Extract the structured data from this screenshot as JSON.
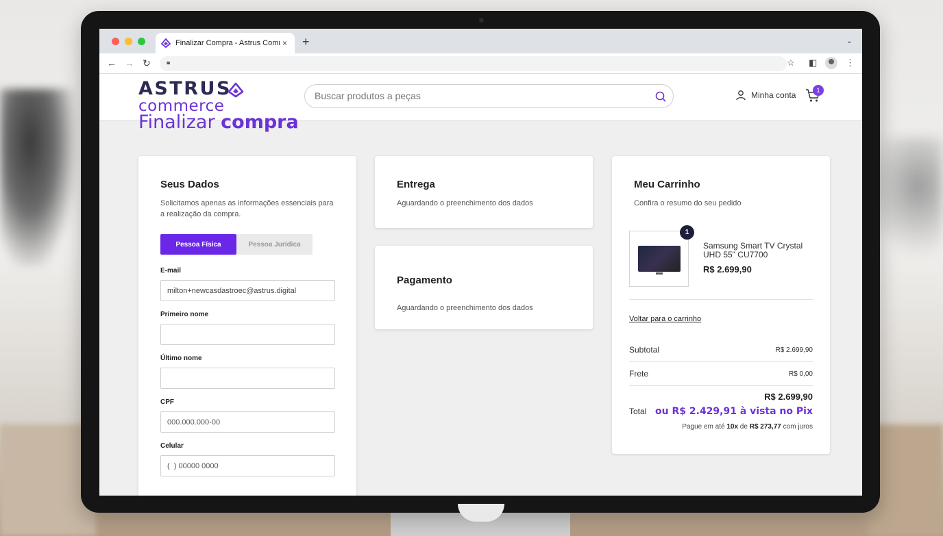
{
  "browser": {
    "tab_title": "Finalizar Compra - Astrus Commerce",
    "new_tab_symbol": "+",
    "close_symbol": "×"
  },
  "header": {
    "logo_top": "ASTRUS",
    "logo_bottom": "commerce",
    "search_placeholder": "Buscar produtos a peças",
    "account_label": "Minha conta",
    "cart_count": "1"
  },
  "page": {
    "title_light": "Finalizar ",
    "title_bold": "compra"
  },
  "dados": {
    "title": "Seus Dados",
    "subtitle": "Solicitamos apenas as informações essenciais para a realização da compra.",
    "tab_pf": "Pessoa Física",
    "tab_pj": "Pessoa Jurídica",
    "email_label": "E-mail",
    "email_value": "milton+newcasdastroec@astrus.digital",
    "first_name_label": "Primeiro nome",
    "last_name_label": "Último nome",
    "cpf_label": "CPF",
    "cpf_placeholder": "000.000.000-00",
    "phone_label": "Celular",
    "phone_placeholder": "(  ) 00000 0000"
  },
  "entrega": {
    "title": "Entrega",
    "subtitle": "Aguardando o preenchimento dos dados"
  },
  "pagamento": {
    "title": "Pagamento",
    "subtitle": "Aguardando o preenchimento dos dados"
  },
  "cart": {
    "title": "Meu Carrinho",
    "subtitle": "Confira o resumo do seu pedido",
    "item_qty": "1",
    "item_name": "Samsung Smart TV Crystal UHD 55\" CU7700",
    "item_price": "R$ 2.699,90",
    "back_link": "Voltar para o carrinho",
    "subtotal_label": "Subtotal",
    "subtotal_value": "R$ 2.699,90",
    "frete_label": "Frete",
    "frete_value": "R$ 0,00",
    "total_label": "Total",
    "total_value": "R$ 2.699,90",
    "pix_text": "ou R$ 2.429,91 à vista no Pix",
    "install_prefix": "Pague em até ",
    "install_count": "10x",
    "install_mid": " de ",
    "install_value": "R$ 273,77",
    "install_suffix": " com juros"
  },
  "colors": {
    "brand_purple": "#6b33d6",
    "button_purple": "#6b27e8",
    "logo_navy": "#2a2a55"
  }
}
